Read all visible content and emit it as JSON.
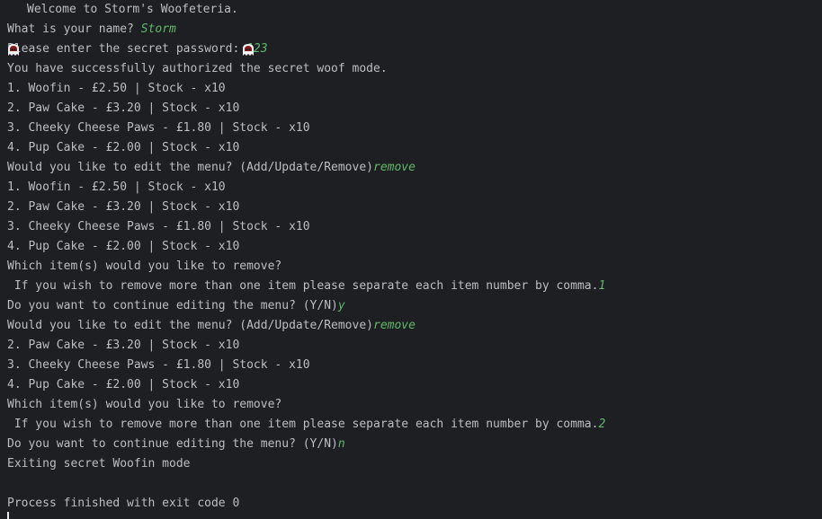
{
  "console": {
    "welcome": "Welcome to Storm's Woofeteria.",
    "lines": [
      {
        "out": "What is your name? ",
        "inp": "Storm"
      },
      {
        "out": "Please enter the secret password: ",
        "inp": "123"
      },
      {
        "out": "You have successfully authorized the secret woof mode.",
        "inp": ""
      },
      {
        "out": "1. Woofin - £2.50 | Stock - x10",
        "inp": ""
      },
      {
        "out": "2. Paw Cake - £3.20 | Stock - x10",
        "inp": ""
      },
      {
        "out": "3. Cheeky Cheese Paws - £1.80 | Stock - x10",
        "inp": ""
      },
      {
        "out": "4. Pup Cake - £2.00 | Stock - x10",
        "inp": ""
      },
      {
        "out": "Would you like to edit the menu? (Add/Update/Remove)",
        "inp": "remove"
      },
      {
        "out": "1. Woofin - £2.50 | Stock - x10",
        "inp": ""
      },
      {
        "out": "2. Paw Cake - £3.20 | Stock - x10",
        "inp": ""
      },
      {
        "out": "3. Cheeky Cheese Paws - £1.80 | Stock - x10",
        "inp": ""
      },
      {
        "out": "4. Pup Cake - £2.00 | Stock - x10",
        "inp": ""
      },
      {
        "out": "Which item(s) would you like to remove?",
        "inp": ""
      },
      {
        "out": " If you wish to remove more than one item please separate each item number by comma.",
        "inp": "1"
      },
      {
        "out": "Do you want to continue editing the menu? (Y/N)",
        "inp": "y"
      },
      {
        "out": "Would you like to edit the menu? (Add/Update/Remove)",
        "inp": "remove"
      },
      {
        "out": "2. Paw Cake - £3.20 | Stock - x10",
        "inp": ""
      },
      {
        "out": "3. Cheeky Cheese Paws - £1.80 | Stock - x10",
        "inp": ""
      },
      {
        "out": "4. Pup Cake - £2.00 | Stock - x10",
        "inp": ""
      },
      {
        "out": "Which item(s) would you like to remove?",
        "inp": ""
      },
      {
        "out": " If you wish to remove more than one item please separate each item number by comma.",
        "inp": "2"
      },
      {
        "out": "Do you want to continue editing the menu? (Y/N)",
        "inp": "n"
      },
      {
        "out": "Exiting secret Woofin mode",
        "inp": ""
      },
      {
        "out": "",
        "inp": ""
      },
      {
        "out": "Process finished with exit code 0",
        "inp": ""
      }
    ]
  },
  "colors": {
    "background": "#1e1f22",
    "output_text": "#bcbec4",
    "user_input": "#5fb86c"
  },
  "icons": {
    "welcome_left": "ghost-icon",
    "welcome_right": "ghost-icon"
  }
}
